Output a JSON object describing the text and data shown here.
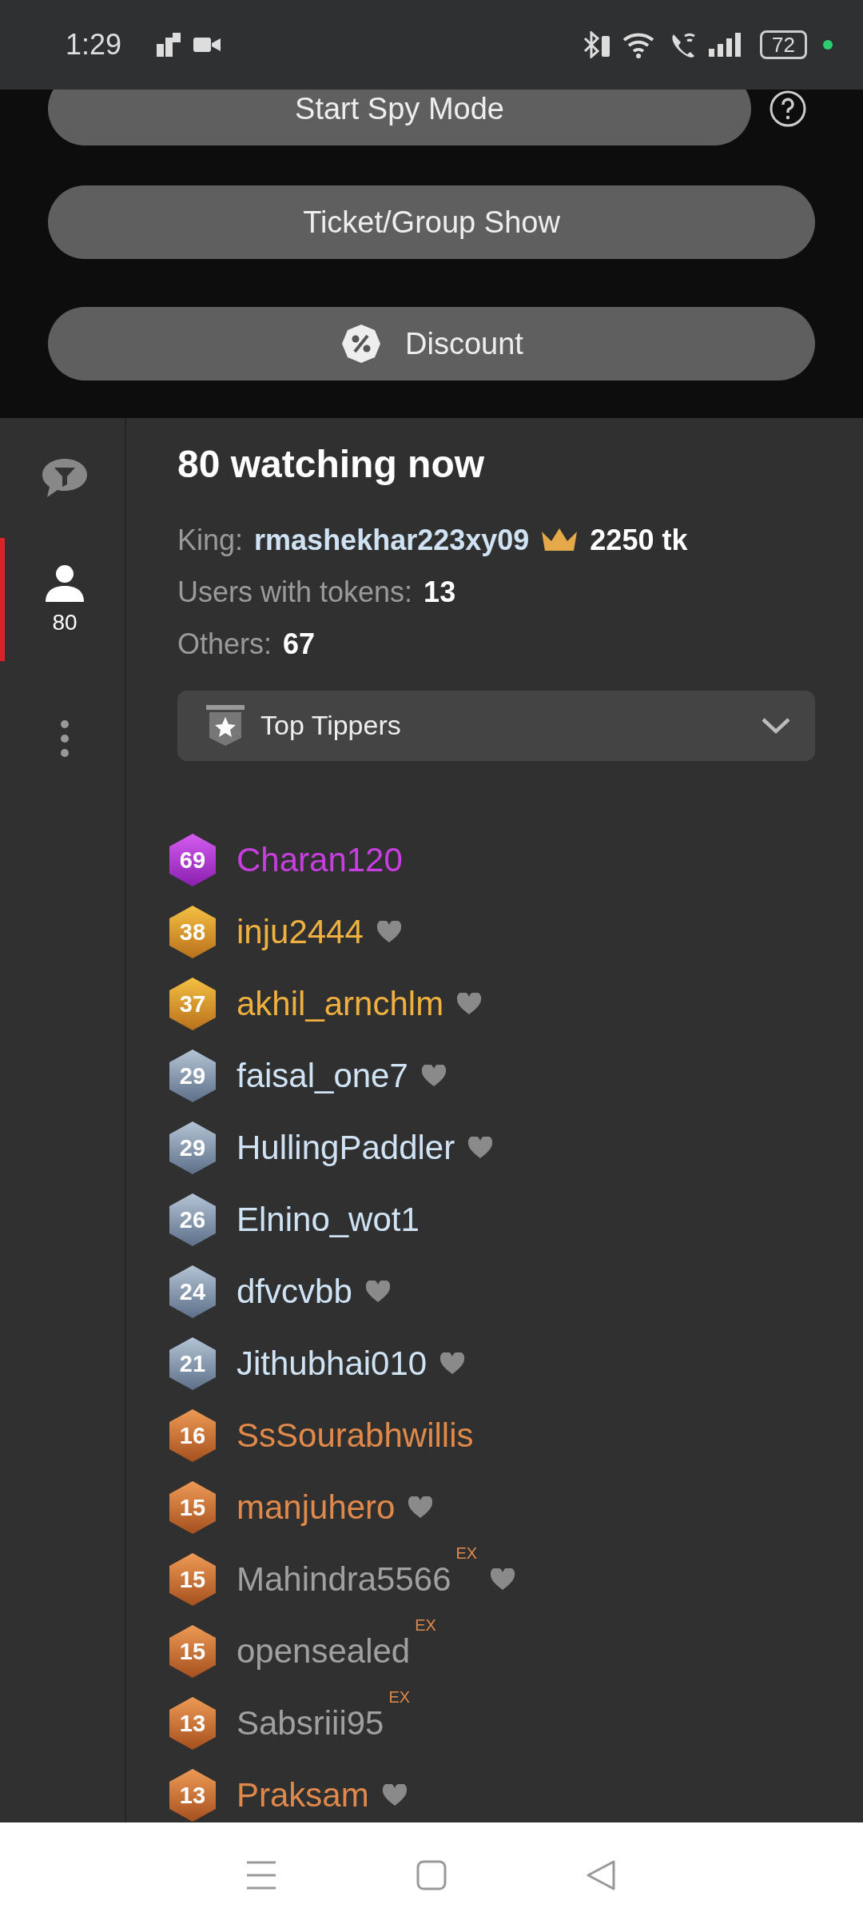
{
  "status_bar": {
    "time": "1:29",
    "battery": "72"
  },
  "actions": [
    {
      "label": "Start Spy Mode",
      "kind": "spy"
    },
    {
      "label": "Ticket/Group Show",
      "kind": "plain"
    },
    {
      "label": "Discount",
      "kind": "discount"
    }
  ],
  "sidebar": {
    "items": [
      {
        "kind": "chat-filter",
        "selected": false
      },
      {
        "kind": "users",
        "count": "80",
        "selected": true
      },
      {
        "kind": "more",
        "selected": false
      }
    ]
  },
  "viewers": {
    "title": "80 watching now",
    "king_label": "King:",
    "king_name": "rmashekhar223xy09",
    "king_amount": "2250 tk",
    "tokens_label": "Users with tokens:",
    "tokens_value": "13",
    "others_label": "Others:",
    "others_value": "67"
  },
  "filter": {
    "label": "Top Tippers"
  },
  "users": [
    {
      "level": "69",
      "kind": "purple",
      "name": "Charan120",
      "color": "#c93ee0",
      "heart": false
    },
    {
      "level": "38",
      "kind": "gold",
      "name": "inju2444",
      "color": "#f0b040",
      "heart": true
    },
    {
      "level": "37",
      "kind": "gold",
      "name": "akhil_arnchlm",
      "color": "#f0b040",
      "heart": true
    },
    {
      "level": "29",
      "kind": "silver",
      "name": "faisal_one7",
      "color": "#cfe3f5",
      "heart": true
    },
    {
      "level": "29",
      "kind": "silver",
      "name": "HullingPaddler",
      "color": "#cfe3f5",
      "heart": true
    },
    {
      "level": "26",
      "kind": "silver",
      "name": "Elnino_wot1",
      "color": "#cfe3f5",
      "heart": false
    },
    {
      "level": "24",
      "kind": "silver",
      "name": "dfvcvbb",
      "color": "#cfe3f5",
      "heart": true
    },
    {
      "level": "21",
      "kind": "silver",
      "name": "Jithubhai010",
      "color": "#cfe3f5",
      "heart": true
    },
    {
      "level": "16",
      "kind": "bronze",
      "name": "SsSourabhwillis",
      "color": "#e0894a",
      "heart": false
    },
    {
      "level": "15",
      "kind": "bronze",
      "name": "manjuhero",
      "color": "#e0894a",
      "heart": true
    },
    {
      "level": "15",
      "kind": "bronze",
      "name": "Mahindra5566",
      "color": "#a0a0a0",
      "tag": "EX",
      "heart": true
    },
    {
      "level": "15",
      "kind": "bronze",
      "name": "opensealed",
      "color": "#a0a0a0",
      "tag": "EX",
      "heart": false
    },
    {
      "level": "13",
      "kind": "bronze",
      "name": "Sabsriii95",
      "color": "#a0a0a0",
      "tag": "EX",
      "heart": false
    },
    {
      "level": "13",
      "kind": "bronze",
      "name": "Praksam",
      "color": "#e0894a",
      "heart": true
    }
  ]
}
